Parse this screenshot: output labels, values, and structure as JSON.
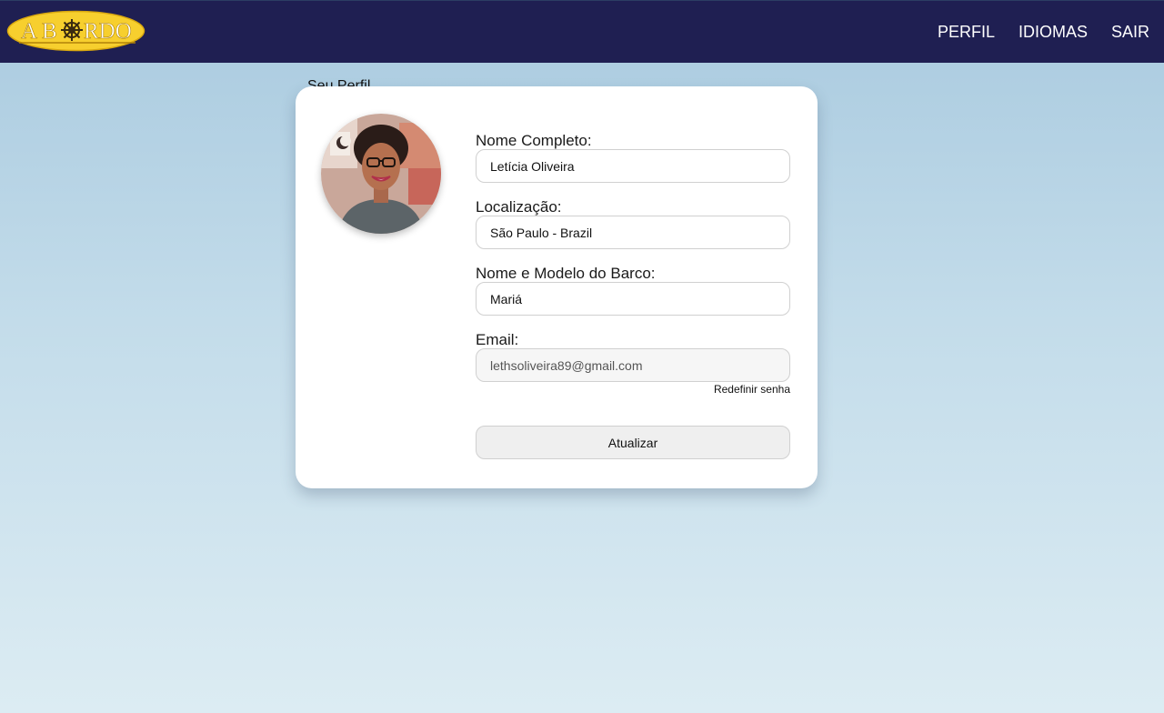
{
  "header": {
    "logo_text": "A B⎈RDO",
    "nav": {
      "perfil": "PERFIL",
      "idiomas": "IDIOMAS",
      "sair": "SAIR"
    }
  },
  "profile": {
    "section_title": "Seu Perfil",
    "fields": {
      "name": {
        "label": "Nome Completo:",
        "value": "Letícia Oliveira"
      },
      "location": {
        "label": "Localização:",
        "value": "São Paulo - Brazil"
      },
      "boat": {
        "label": "Nome e Modelo do Barco:",
        "value": "Mariá"
      },
      "email": {
        "label": "Email:",
        "value": "lethsoliveira89@gmail.com"
      }
    },
    "reset_password": "Redefinir senha",
    "submit": "Atualizar"
  },
  "colors": {
    "topbar": "#1f1f52",
    "logo_fill": "#f7cf2e"
  }
}
